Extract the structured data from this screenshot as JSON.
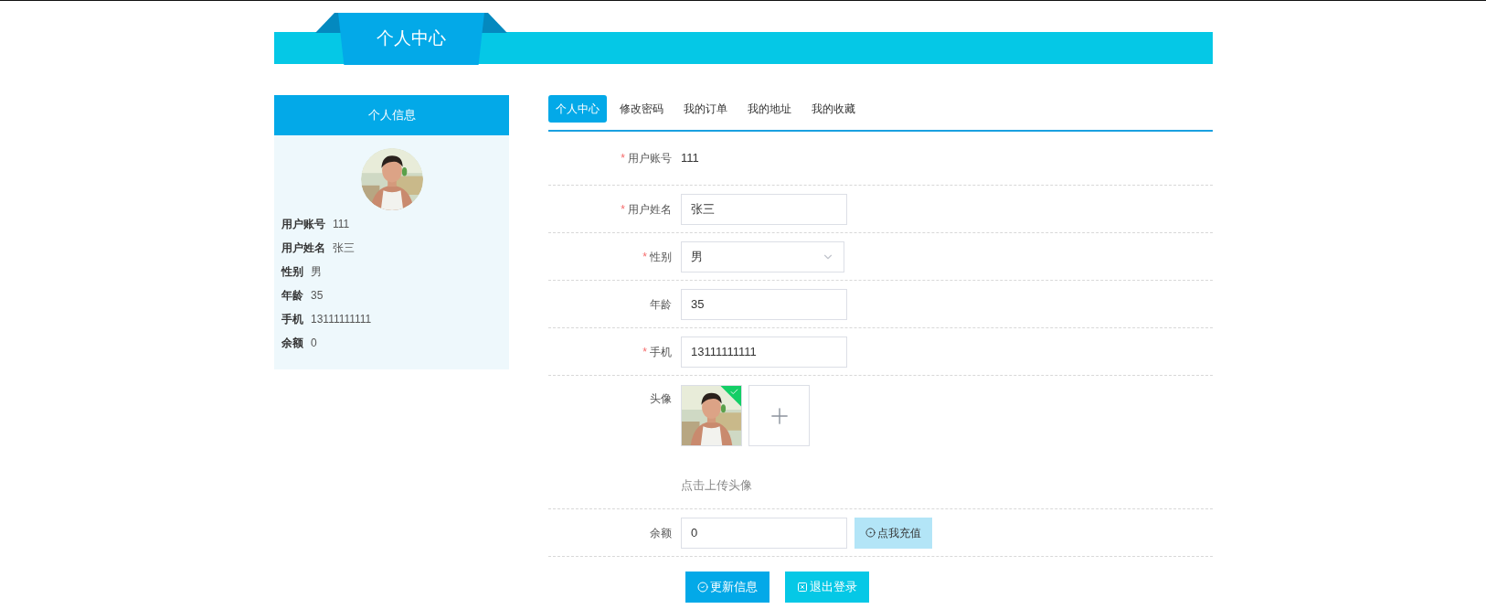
{
  "header": {
    "title": "个人中心"
  },
  "sidebar": {
    "title": "个人信息",
    "fields": [
      {
        "label": "用户账号",
        "value": "111"
      },
      {
        "label": "用户姓名",
        "value": "张三"
      },
      {
        "label": "性别",
        "value": "男"
      },
      {
        "label": "年龄",
        "value": "35"
      },
      {
        "label": "手机",
        "value": "13111111111"
      },
      {
        "label": "余额",
        "value": "0"
      }
    ]
  },
  "tabs": [
    {
      "label": "个人中心",
      "selected": true
    },
    {
      "label": "修改密码",
      "selected": false
    },
    {
      "label": "我的订单",
      "selected": false
    },
    {
      "label": "我的地址",
      "selected": false
    },
    {
      "label": "我的收藏",
      "selected": false
    }
  ],
  "form": {
    "required_mark": "*",
    "rows": [
      {
        "kind": "text",
        "label": "用户账号",
        "required": true,
        "value": "111"
      },
      {
        "kind": "input",
        "label": "用户姓名",
        "required": true,
        "value": "张三"
      },
      {
        "kind": "select",
        "label": "性别",
        "required": true,
        "value": "男"
      },
      {
        "kind": "input",
        "label": "年龄",
        "required": false,
        "value": "35"
      },
      {
        "kind": "input",
        "label": "手机",
        "required": true,
        "value": "13111111111"
      },
      {
        "kind": "upload",
        "label": "头像",
        "required": false,
        "uploaded": true,
        "hint": "点击上传头像"
      },
      {
        "kind": "input_action",
        "label": "余额",
        "required": false,
        "value": "0",
        "action": "点我充值"
      }
    ]
  },
  "buttons": [
    {
      "label": "更新信息",
      "kind": "update"
    },
    {
      "label": "退出登录",
      "kind": "logout"
    }
  ]
}
